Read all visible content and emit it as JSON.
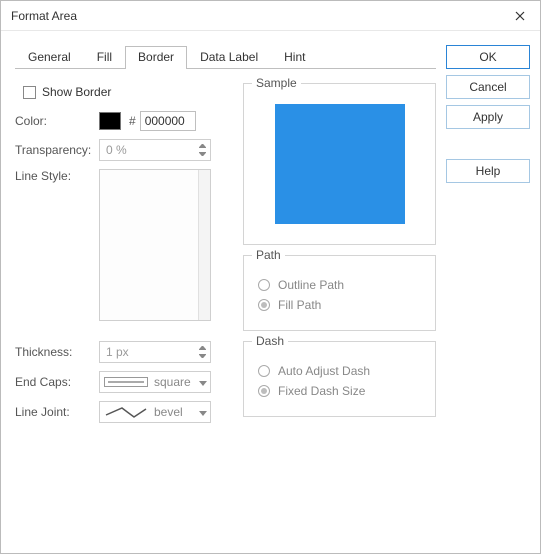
{
  "dialog": {
    "title": "Format Area"
  },
  "tabs": {
    "general": "General",
    "fill": "Fill",
    "border": "Border",
    "data_label": "Data Label",
    "hint": "Hint"
  },
  "buttons": {
    "ok": "OK",
    "cancel": "Cancel",
    "apply": "Apply",
    "help": "Help"
  },
  "border": {
    "show_border_label": "Show Border",
    "color_label": "Color:",
    "color_hex": "000000",
    "transparency_label": "Transparency:",
    "transparency_value": "0 %",
    "line_style_label": "Line Style:",
    "thickness_label": "Thickness:",
    "thickness_value": "1 px",
    "end_caps_label": "End Caps:",
    "end_caps_value": "square",
    "line_joint_label": "Line Joint:",
    "line_joint_value": "bevel"
  },
  "sample": {
    "legend": "Sample",
    "color": "#2a90e6"
  },
  "path": {
    "legend": "Path",
    "outline": "Outline Path",
    "fill": "Fill Path"
  },
  "dash": {
    "legend": "Dash",
    "auto": "Auto Adjust Dash",
    "fixed": "Fixed Dash Size"
  }
}
